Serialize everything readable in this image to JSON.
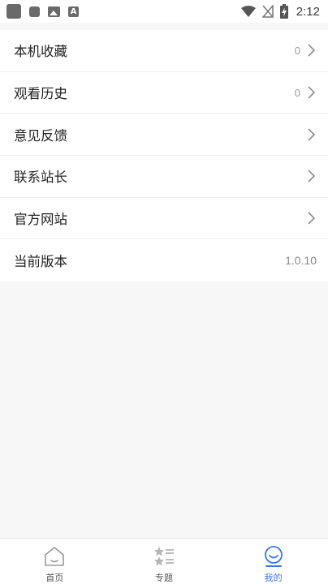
{
  "status_bar": {
    "time": "2:12",
    "left_icons": [
      "app-square-icon",
      "app-small-square-icon",
      "image-icon",
      "font-a-icon"
    ],
    "right_icons": [
      "wifi-icon",
      "no-signal-icon",
      "battery-charging-icon"
    ]
  },
  "menu": {
    "items": [
      {
        "label": "本机收藏",
        "value": "0",
        "chevron": true
      },
      {
        "label": "观看历史",
        "value": "0",
        "chevron": true
      },
      {
        "label": "意见反馈",
        "value": "",
        "chevron": true
      },
      {
        "label": "联系站长",
        "value": "",
        "chevron": true
      },
      {
        "label": "官方网站",
        "value": "",
        "chevron": true
      },
      {
        "label": "当前版本",
        "value": "1.0.10",
        "chevron": false
      }
    ]
  },
  "tabbar": {
    "tabs": [
      {
        "label": "首页",
        "icon": "home-icon",
        "active": false
      },
      {
        "label": "专题",
        "icon": "star-list-icon",
        "active": false
      },
      {
        "label": "我的",
        "icon": "smile-icon",
        "active": true
      }
    ]
  },
  "colors": {
    "accent": "#3a76e6",
    "background": "#f7f7f7",
    "text": "#222222",
    "muted": "#9a9a9a"
  }
}
